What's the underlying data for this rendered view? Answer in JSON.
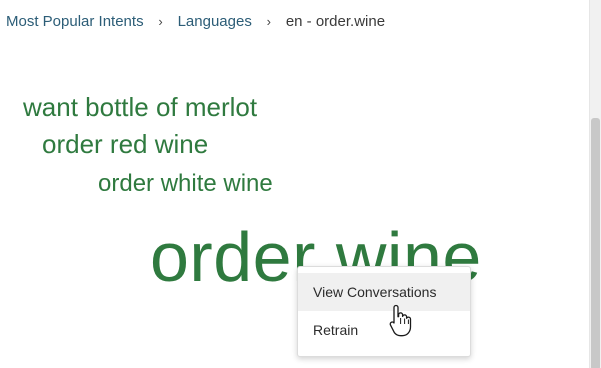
{
  "breadcrumb": {
    "items": [
      {
        "label": "Most Popular Intents"
      },
      {
        "label": "Languages"
      },
      {
        "label": "en - order.wine"
      }
    ],
    "separator": "›"
  },
  "word_cloud": {
    "phrases": [
      {
        "text": "want bottle of merlot"
      },
      {
        "text": "order red wine"
      },
      {
        "text": "order white wine"
      },
      {
        "text": "order wine"
      }
    ],
    "color": "#2f7a3f"
  },
  "context_menu": {
    "items": [
      {
        "label": "View Conversations",
        "hovered": true
      },
      {
        "label": "Retrain",
        "hovered": false
      }
    ]
  },
  "colors": {
    "link": "#2c5d77",
    "phrase_green": "#2f7a3f",
    "menu_hover": "#f0f0f0"
  },
  "icons": {
    "pointer": "hand-pointer-icon",
    "separator": "chevron-right-icon"
  }
}
